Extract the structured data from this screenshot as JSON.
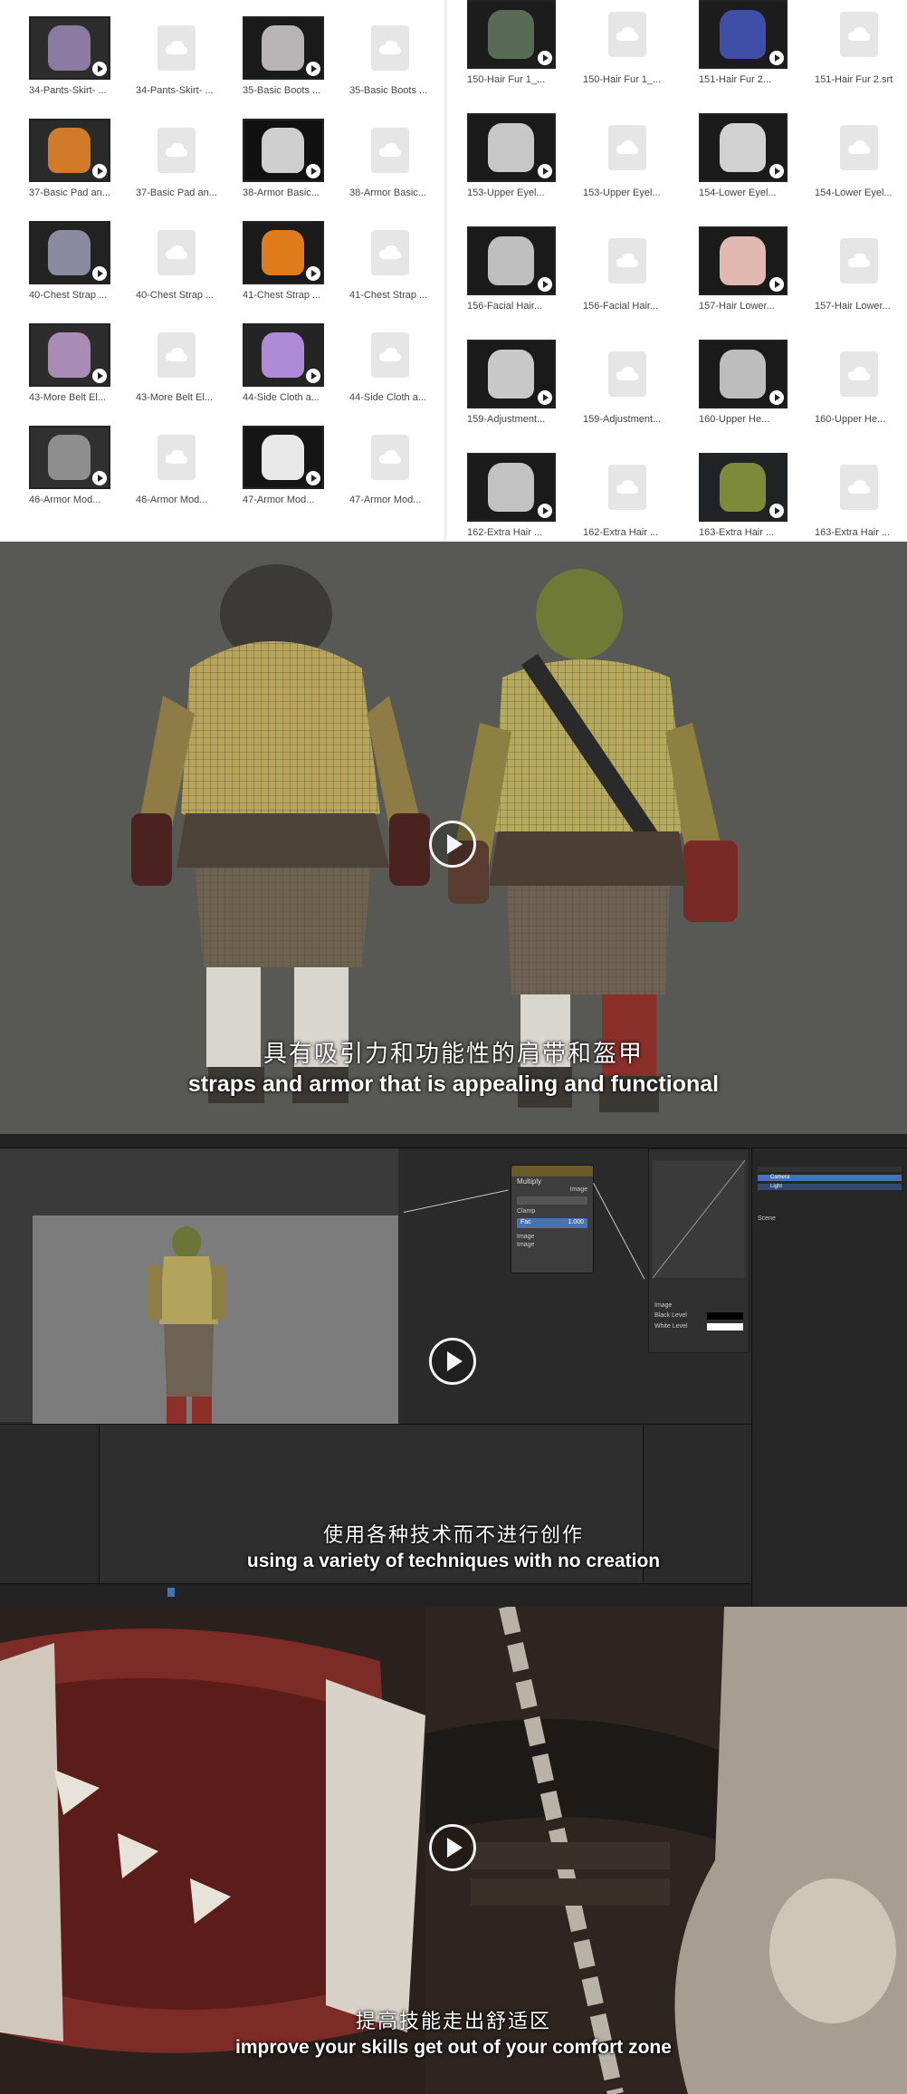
{
  "files_left": [
    {
      "name": "34-Pants-Skirt- ...",
      "kind": "video",
      "art": "purple-figure"
    },
    {
      "name": "34-Pants-Skirt- ...",
      "kind": "cloud"
    },
    {
      "name": "35-Basic Boots ...",
      "kind": "video",
      "art": "boots"
    },
    {
      "name": "35-Basic Boots ...",
      "kind": "cloud"
    },
    {
      "name": "37-Basic Pad an...",
      "kind": "video",
      "art": "orange-pad"
    },
    {
      "name": "37-Basic Pad an...",
      "kind": "cloud"
    },
    {
      "name": "38-Armor Basic...",
      "kind": "video",
      "art": "armor-plate"
    },
    {
      "name": "38-Armor Basic...",
      "kind": "cloud"
    },
    {
      "name": "40-Chest Strap ...",
      "kind": "video",
      "art": "chest"
    },
    {
      "name": "40-Chest Strap ...",
      "kind": "cloud"
    },
    {
      "name": "41-Chest Strap ...",
      "kind": "video",
      "art": "orange-strap"
    },
    {
      "name": "41-Chest Strap ...",
      "kind": "cloud"
    },
    {
      "name": "43-More Belt El...",
      "kind": "video",
      "art": "belt"
    },
    {
      "name": "43-More Belt El...",
      "kind": "cloud"
    },
    {
      "name": "44-Side Cloth a...",
      "kind": "video",
      "art": "cloth"
    },
    {
      "name": "44-Side Cloth a...",
      "kind": "cloud"
    },
    {
      "name": "46-Armor Mod...",
      "kind": "video",
      "art": "armor-mod"
    },
    {
      "name": "46-Armor Mod...",
      "kind": "cloud"
    },
    {
      "name": "47-Armor Mod...",
      "kind": "video",
      "art": "outline"
    },
    {
      "name": "47-Armor Mod...",
      "kind": "cloud"
    }
  ],
  "files_right": [
    {
      "name": "150-Hair Fur 1_...",
      "kind": "video",
      "art": "dark-head"
    },
    {
      "name": "150-Hair Fur 1_...",
      "kind": "cloud"
    },
    {
      "name": "151-Hair Fur 2...",
      "kind": "video",
      "art": "blue-head"
    },
    {
      "name": "151-Hair Fur 2.srt",
      "kind": "cloud"
    },
    {
      "name": "153-Upper Eyel...",
      "kind": "video",
      "art": "eye"
    },
    {
      "name": "153-Upper Eyel...",
      "kind": "cloud"
    },
    {
      "name": "154-Lower Eyel...",
      "kind": "video",
      "art": "eye2"
    },
    {
      "name": "154-Lower Eyel...",
      "kind": "cloud"
    },
    {
      "name": "156-Facial Hair...",
      "kind": "video",
      "art": "face"
    },
    {
      "name": "156-Facial Hair...",
      "kind": "cloud"
    },
    {
      "name": "157-Hair Lower...",
      "kind": "video",
      "art": "skin"
    },
    {
      "name": "157-Hair Lower...",
      "kind": "cloud"
    },
    {
      "name": "159-Adjustment...",
      "kind": "video",
      "art": "orc-grey"
    },
    {
      "name": "159-Adjustment...",
      "kind": "cloud"
    },
    {
      "name": "160-Upper He...",
      "kind": "video",
      "art": "head-grey"
    },
    {
      "name": "160-Upper He...",
      "kind": "cloud"
    },
    {
      "name": "162-Extra Hair ...",
      "kind": "video",
      "art": "orc-grey2"
    },
    {
      "name": "162-Extra Hair ...",
      "kind": "cloud"
    },
    {
      "name": "163-Extra Hair ...",
      "kind": "video",
      "art": "orc-color"
    },
    {
      "name": "163-Extra Hair ...",
      "kind": "cloud"
    }
  ],
  "video1": {
    "subtitle_cn": "具有吸引力和功能性的肩带和盔甲",
    "subtitle_en": "straps and armor that is appealing and functional"
  },
  "video2": {
    "subtitle_cn": "使用各种技术而不进行创作",
    "subtitle_en": "using a variety of techniques with no creation",
    "node_title": "Multiply",
    "node_fac": "Fac",
    "node_fac_value": "1.000",
    "node_image": "Image",
    "node_clamp": "Clamp",
    "levels_black": "Black Level",
    "levels_white": "White Level",
    "outliner_camera": "Camera",
    "outliner_light": "Light",
    "scene_label": "Scene"
  },
  "video3": {
    "subtitle_cn": "提高技能走出舒适区",
    "subtitle_en": "improve your skills get out of your comfort zone"
  },
  "colors": {
    "cloud_doc": "#e6e6e6",
    "node_header": "#6a5a2a",
    "blender_bg": "#2b2b2b"
  }
}
